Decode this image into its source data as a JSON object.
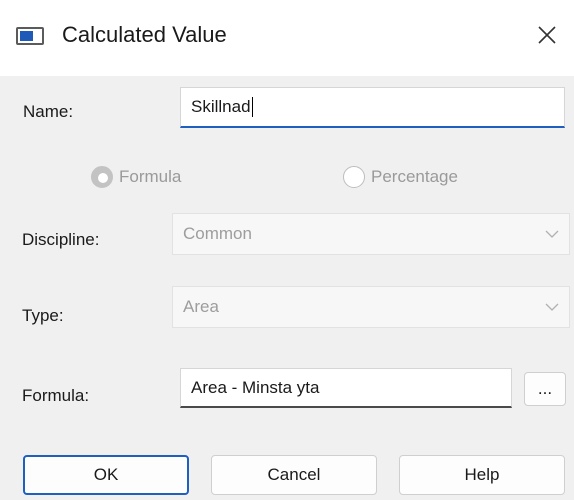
{
  "window": {
    "title": "Calculated Value"
  },
  "form": {
    "name_label": "Name:",
    "name_value": "Skillnad",
    "mode_options": [
      {
        "label": "Formula",
        "selected": true
      },
      {
        "label": "Percentage",
        "selected": false
      }
    ],
    "discipline_label": "Discipline:",
    "discipline_value": "Common",
    "type_label": "Type:",
    "type_value": "Area",
    "formula_label": "Formula:",
    "formula_value": "Area - Minsta yta",
    "browse_label": "..."
  },
  "buttons": {
    "ok": "OK",
    "cancel": "Cancel",
    "help": "Help"
  },
  "icons": {
    "app": "dialog-window-icon",
    "close": "close-icon",
    "dropdown": "chevron-down-icon"
  },
  "colors": {
    "accent": "#1f5fbf",
    "background": "#f0f0f0",
    "disabled_text": "#9d9d9d"
  }
}
